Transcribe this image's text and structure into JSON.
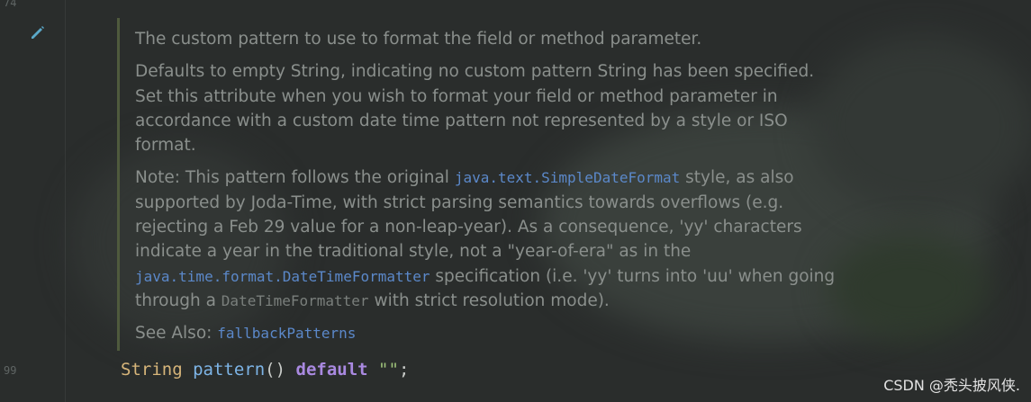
{
  "gutter": {
    "line_top": "74",
    "line_bottom": "99"
  },
  "doc": {
    "summary": "The custom pattern to use to format the field or method parameter.",
    "para1": "Defaults to empty String, indicating no custom pattern String has been specified. Set this attribute when you wish to format your field or method parameter in accordance with a custom date time pattern not represented by a style or ISO format.",
    "note_prefix": "Note: This pattern follows the original ",
    "note_code1": "java.text.SimpleDateFormat",
    "note_mid1": " style, as also supported by Joda-Time, with strict parsing semantics towards overflows (e.g. rejecting a Feb 29 value for a non-leap-year). As a consequence, 'yy' characters indicate a year in the traditional style, not a \"year-of-era\" as in the ",
    "note_code2": "java.time.format.DateTimeFormatter",
    "note_mid2": " specification (i.e. 'yy' turns into 'uu' when going through a ",
    "note_code3": "DateTimeFormatter",
    "note_end": " with strict resolution mode).",
    "see_also_label": "See Also:",
    "see_also_link": "fallbackPatterns"
  },
  "code_line": {
    "type": "String",
    "method": "pattern",
    "parens": "()",
    "keyword": "default",
    "value": "\"\"",
    "semicolon": ";"
  },
  "watermark": "CSDN @秃头披风侠.",
  "colors": {
    "background": "#2a2d2c",
    "doc_text": "#8a8f8c",
    "code_link": "#5b88c9",
    "doc_bar": "#4f5a3d",
    "keyword_default": "#a989e0",
    "type_color": "#d7b57a"
  },
  "icons": {
    "edit": "pencil-icon"
  }
}
